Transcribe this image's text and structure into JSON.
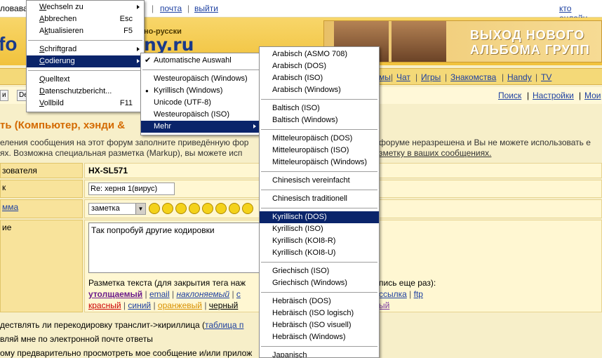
{
  "topbar": {
    "left_text": "ловавати",
    "mail": "почта",
    "logout": "выйти",
    "online": "кто онлайн"
  },
  "banner": {
    "logo_left": "fo",
    "logo_sub": "но-русски",
    "logo_main": "ny.ru",
    "promo_line1": "ВЫХОД НОВОГО",
    "promo_line2": "АЛЬБОМА ГРУПП"
  },
  "nav": {
    "items": [
      "мы",
      "Чат",
      "Игры",
      "Знакомства",
      "Handy",
      "TV"
    ]
  },
  "subnav": {
    "btn1": "и",
    "btn2": "De",
    "search": "Поиск",
    "settings": "Настройки",
    "mine": "Мои"
  },
  "page": {
    "heading": "ть (Компьютер, хэнди &",
    "info1_left": "еления сообщения на этот форум заполните приведённую фор",
    "info1_right": "форуме неразрешена и Вы не можете использовать е",
    "info2_left": "ях. Возможна специальная разметка (Markup), вы можете исп",
    "info2_right": "зметку в ваших сообщениях."
  },
  "form": {
    "user_label": "зователя",
    "user_value": "HX-SL571",
    "subject_label": "к",
    "subject_value": "Re: херня 1(вирус)",
    "type_label": "мма",
    "type_value": "заметка",
    "message_label": "ие",
    "message_value": "Так попробуй другие кодировки",
    "markup_intro": "Разметка текста (для закрытия тега наж",
    "markup_intro_right": "пись еще раз):",
    "markup_bold": "утолщаемый",
    "markup_email": "email",
    "markup_italic": "наклоняемый",
    "markup_c": "с",
    "markup_link": "ссылка",
    "markup_ftp": "ftp",
    "markup_red": "красный",
    "markup_blue": "синий",
    "markup_orange": "оранжевый",
    "markup_black": "черный",
    "markup_right2": "ый"
  },
  "options": {
    "translit": "дествлять ли перекодировку транслит->кириллица (",
    "translit_link": "таблица п",
    "email_replies": "вляй мне по электронной почте ответы",
    "preview": "ому предварительно просмотреть мое сообщение и/или прилож"
  },
  "menu_main": [
    {
      "label": "Wechseln zu",
      "ul": "W",
      "shortcut": "",
      "submenu": true
    },
    {
      "label": "Abbrechen",
      "ul": "A",
      "shortcut": "Esc",
      "submenu": false
    },
    {
      "label": "Aktualisieren",
      "ul": "k",
      "shortcut": "F5",
      "submenu": false
    },
    {
      "sep": true
    },
    {
      "label": "Schriftgrad",
      "ul": "S",
      "shortcut": "",
      "submenu": true
    },
    {
      "label": "Codierung",
      "ul": "C",
      "shortcut": "",
      "submenu": true,
      "highlight": true
    },
    {
      "sep": true
    },
    {
      "label": "Quelltext",
      "ul": "Q",
      "shortcut": "",
      "submenu": false
    },
    {
      "label": "Datenschutzbericht...",
      "ul": "D",
      "shortcut": "",
      "submenu": false
    },
    {
      "label": "Vollbild",
      "ul": "V",
      "shortcut": "F11",
      "submenu": false
    }
  ],
  "menu_codierung": [
    {
      "label": "Automatische Auswahl",
      "mark": "check"
    },
    {
      "sep": true
    },
    {
      "label": "Westeuropäisch (Windows)"
    },
    {
      "label": "Kyrillisch (Windows)",
      "mark": "dot"
    },
    {
      "label": "Unicode (UTF-8)"
    },
    {
      "label": "Westeuropäisch (ISO)"
    },
    {
      "label": "Mehr",
      "submenu": true,
      "highlight": true
    }
  ],
  "menu_mehr": [
    {
      "label": "Arabisch (ASMO 708)"
    },
    {
      "label": "Arabisch (DOS)"
    },
    {
      "label": "Arabisch (ISO)"
    },
    {
      "label": "Arabisch (Windows)"
    },
    {
      "sep": true
    },
    {
      "label": "Baltisch (ISO)"
    },
    {
      "label": "Baltisch (Windows)"
    },
    {
      "sep": true
    },
    {
      "label": "Mitteleuropäisch (DOS)"
    },
    {
      "label": "Mitteleuropäisch (ISO)"
    },
    {
      "label": "Mitteleuropäisch (Windows)"
    },
    {
      "sep": true
    },
    {
      "label": "Chinesisch vereinfacht"
    },
    {
      "sep": true
    },
    {
      "label": "Chinesisch traditionell"
    },
    {
      "sep": true
    },
    {
      "label": "Kyrillisch (DOS)",
      "highlight": true
    },
    {
      "label": "Kyrillisch (ISO)"
    },
    {
      "label": "Kyrillisch (KOI8-R)"
    },
    {
      "label": "Kyrillisch (KOI8-U)"
    },
    {
      "sep": true
    },
    {
      "label": "Griechisch (ISO)"
    },
    {
      "label": "Griechisch (Windows)"
    },
    {
      "sep": true
    },
    {
      "label": "Hebräisch (DOS)"
    },
    {
      "label": "Hebräisch (ISO logisch)"
    },
    {
      "label": "Hebräisch (ISO visuell)"
    },
    {
      "label": "Hebräisch (Windows)"
    },
    {
      "sep": true
    },
    {
      "label": "Japanisch"
    }
  ],
  "colors": {
    "menu_highlight": "#0a246a",
    "link": "#1c3fa0",
    "heading": "#d46a00",
    "markup_bold": "#6a1a8a",
    "markup_red": "#cc0000",
    "markup_orange": "#d89000"
  }
}
